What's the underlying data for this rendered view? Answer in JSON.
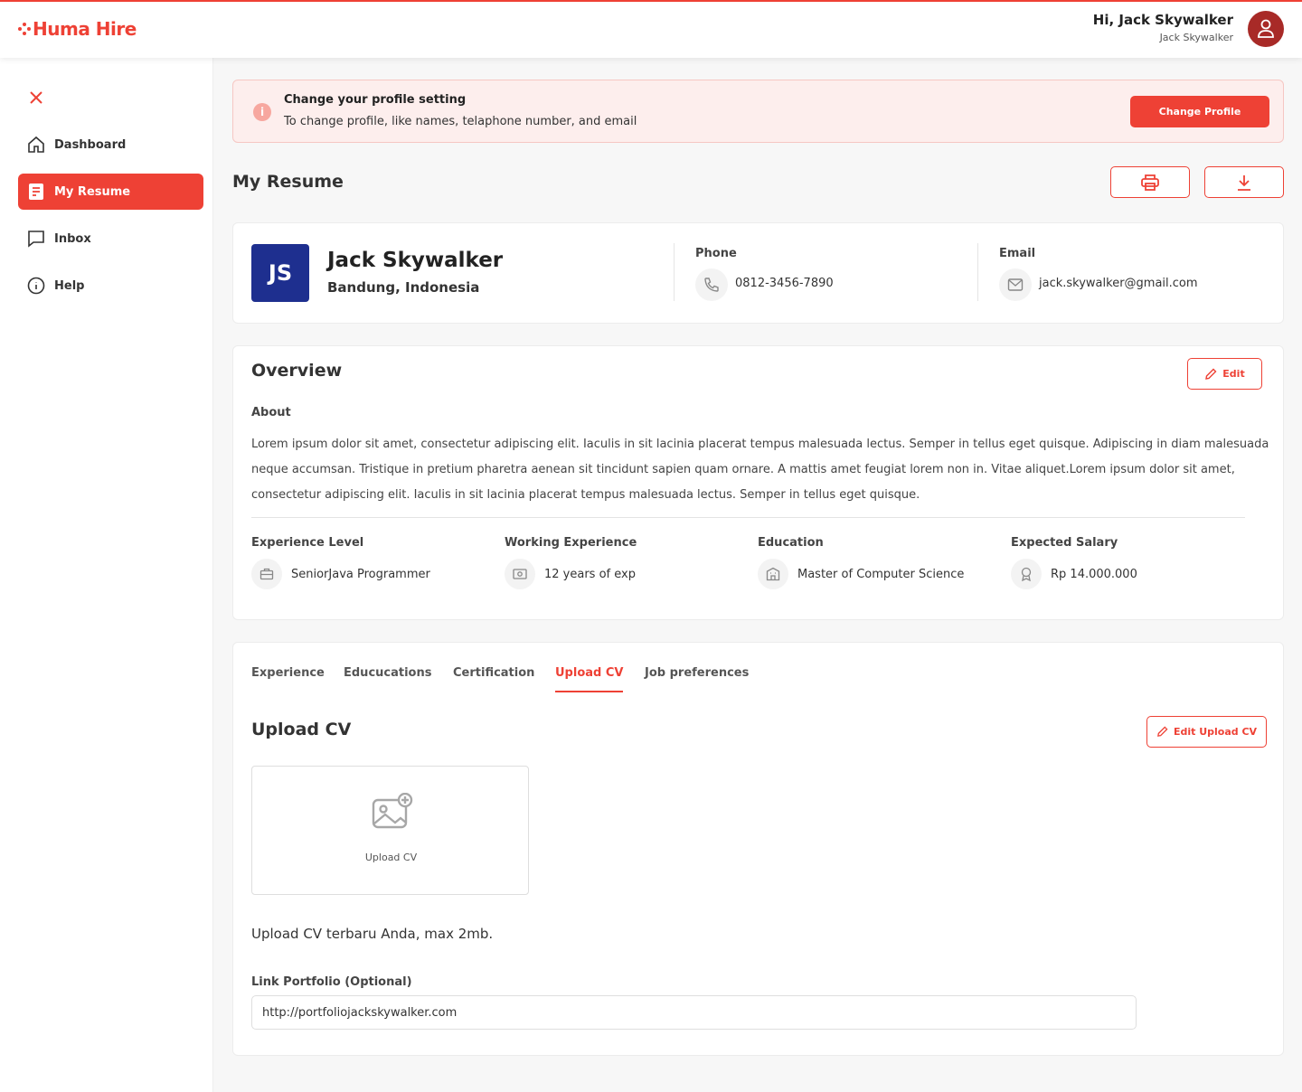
{
  "brand": {
    "name": "Huma Hire",
    "accent": "#ee4135"
  },
  "header": {
    "greeting": "Hi, Jack Skywalker",
    "username": "Jack Skywalker"
  },
  "sidebar": {
    "items": [
      {
        "label": "Dashboard",
        "icon": "home-icon"
      },
      {
        "label": "My Resume",
        "icon": "resume-icon",
        "active": true
      },
      {
        "label": "Inbox",
        "icon": "chat-icon"
      },
      {
        "label": "Help",
        "icon": "info-icon"
      }
    ]
  },
  "notice": {
    "title": "Change your profile setting",
    "text": "To change profile, like names, telaphone number, and email",
    "button": "Change Profile"
  },
  "page": {
    "title": "My Resume"
  },
  "profile": {
    "initials": "JS",
    "name": "Jack Skywalker",
    "location": "Bandung, Indonesia",
    "phone_label": "Phone",
    "phone": "0812-3456-7890",
    "email_label": "Email",
    "email": "jack.skywalker@gmail.com"
  },
  "overview": {
    "title": "Overview",
    "edit_label": "Edit",
    "about_label": "About",
    "about_text": "Lorem ipsum dolor sit amet, consectetur adipiscing elit. Iaculis in sit lacinia placerat tempus malesuada lectus. Semper in tellus eget quisque. Adipiscing in diam malesuada neque accumsan. Tristique in pretium pharetra aenean sit tincidunt sapien quam ornare. A mattis amet feugiat lorem non in. Vitae aliquet.Lorem ipsum dolor sit amet, consectetur adipiscing elit. Iaculis in sit lacinia placerat tempus malesuada lectus. Semper in tellus eget quisque.",
    "stats": [
      {
        "label": "Experience Level",
        "value": "SeniorJava Programmer",
        "icon": "briefcase-icon"
      },
      {
        "label": "Working Experience",
        "value": "12 years of exp",
        "icon": "money-icon"
      },
      {
        "label": "Education",
        "value": "Master of Computer Science",
        "icon": "building-icon"
      },
      {
        "label": "Expected Salary",
        "value": "Rp 14.000.000",
        "icon": "award-icon"
      }
    ]
  },
  "tabs": [
    {
      "label": "Experience"
    },
    {
      "label": "Educucations"
    },
    {
      "label": "Certification"
    },
    {
      "label": "Upload CV",
      "active": true
    },
    {
      "label": "Job preferences"
    }
  ],
  "upload": {
    "title": "Upload CV",
    "edit_label": "Edit Upload CV",
    "box_label": "Upload CV",
    "note": "Upload CV terbaru Anda, max 2mb.",
    "portfolio_label": "Link Portfolio (Optional)",
    "portfolio_value": "http://portfoliojackskywalker.com"
  }
}
